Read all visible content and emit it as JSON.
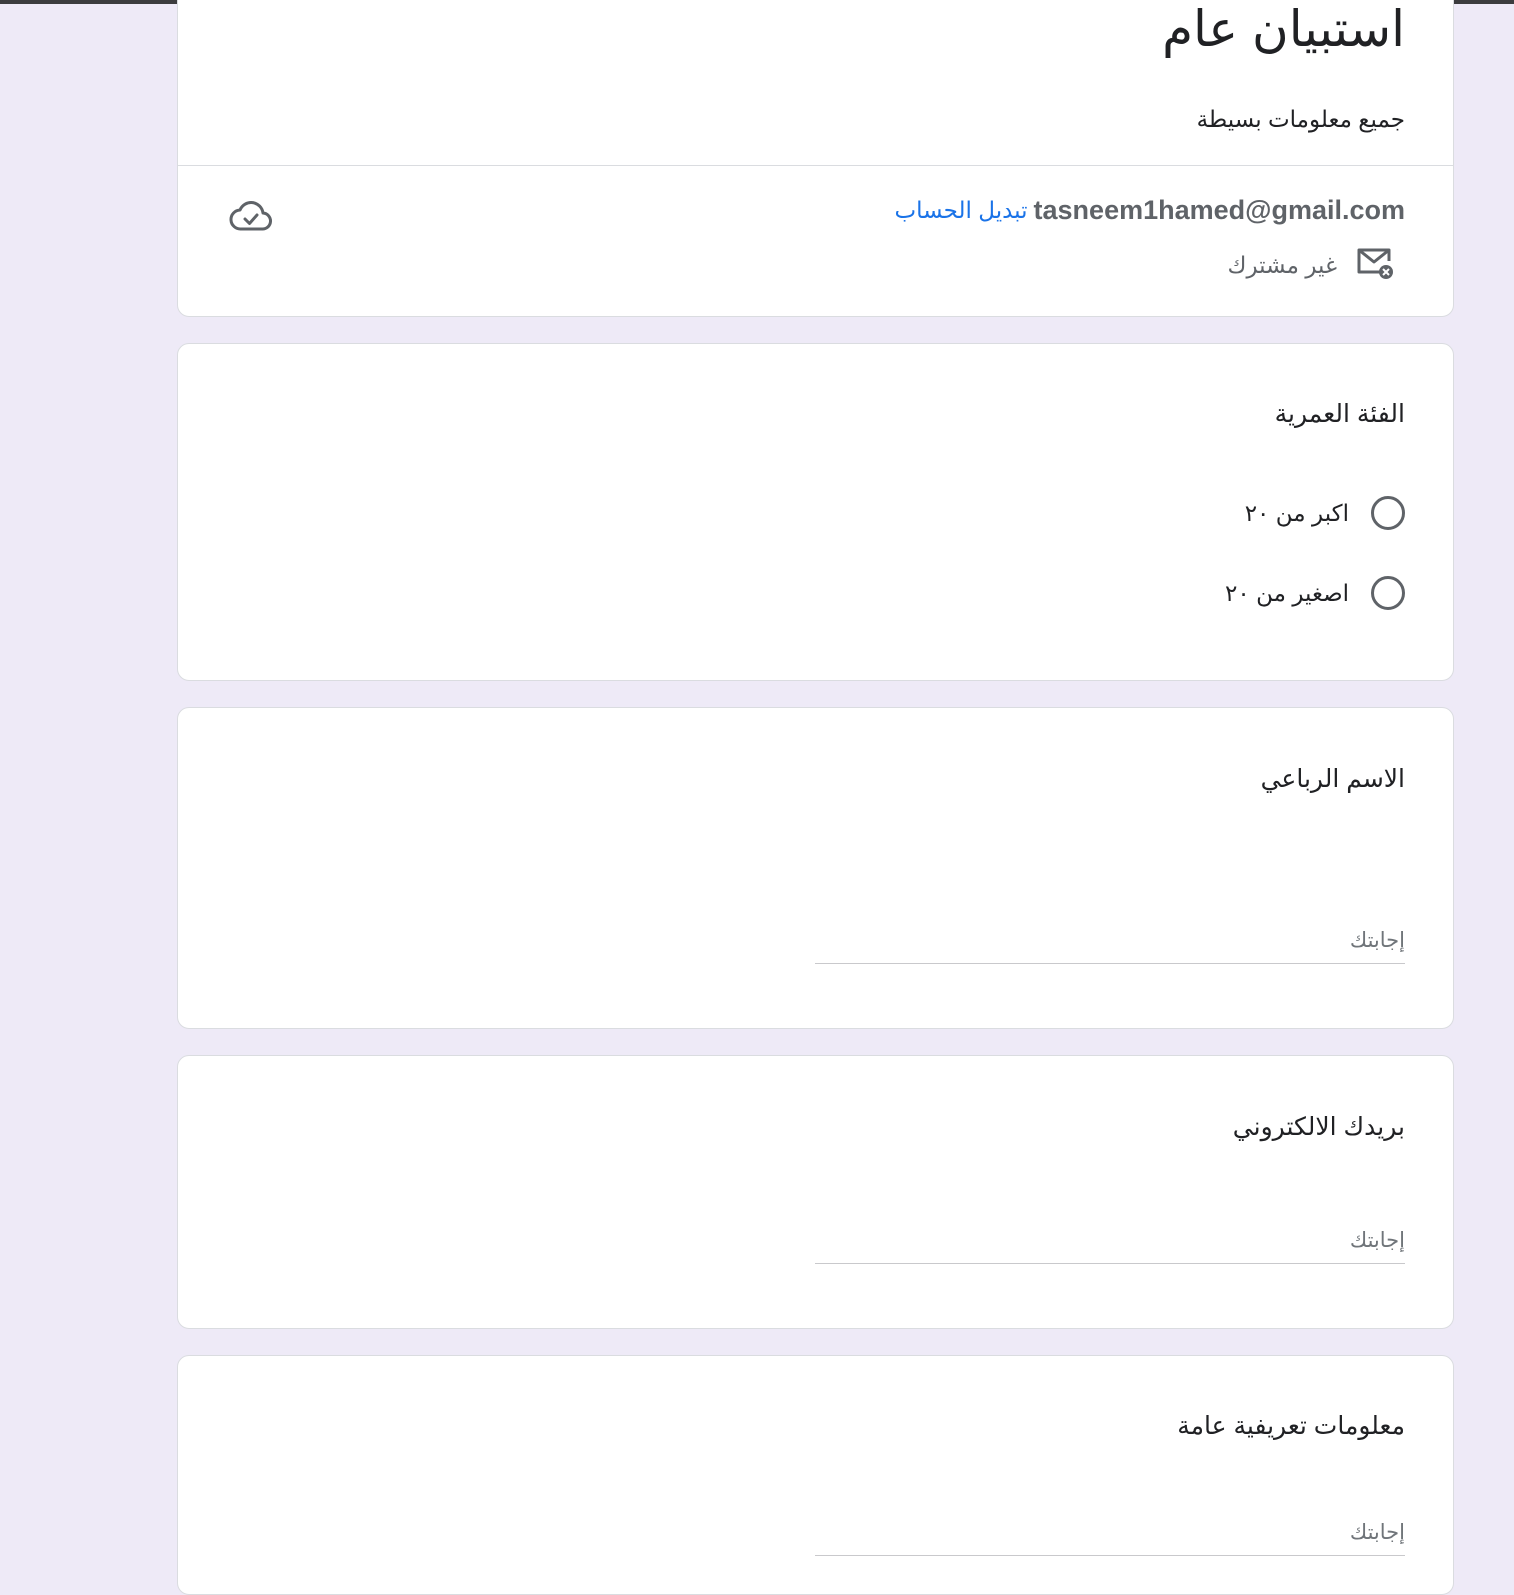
{
  "form": {
    "title": "استبيان عام",
    "description": "جميع معلومات بسيطة"
  },
  "account": {
    "email": "tasneem1hamed@gmail.com",
    "switch_label": "تبديل الحساب",
    "not_shared_label": "غير مشترك"
  },
  "questions": [
    {
      "title": "الفئة العمرية",
      "type": "radio",
      "options": [
        "اكبر من ٢٠",
        "اصغير من ٢٠"
      ]
    },
    {
      "title": "الاسم الرباعي",
      "type": "text",
      "placeholder": "إجابتك"
    },
    {
      "title": "بريدك الالكتروني",
      "type": "text",
      "placeholder": "إجابتك"
    },
    {
      "title": "معلومات تعريفية عامة",
      "type": "text",
      "placeholder": "إجابتك"
    }
  ],
  "colors": {
    "background": "#eeeaf7",
    "link": "#1a73e8",
    "text": "#202124",
    "secondary_text": "#5f6368"
  }
}
